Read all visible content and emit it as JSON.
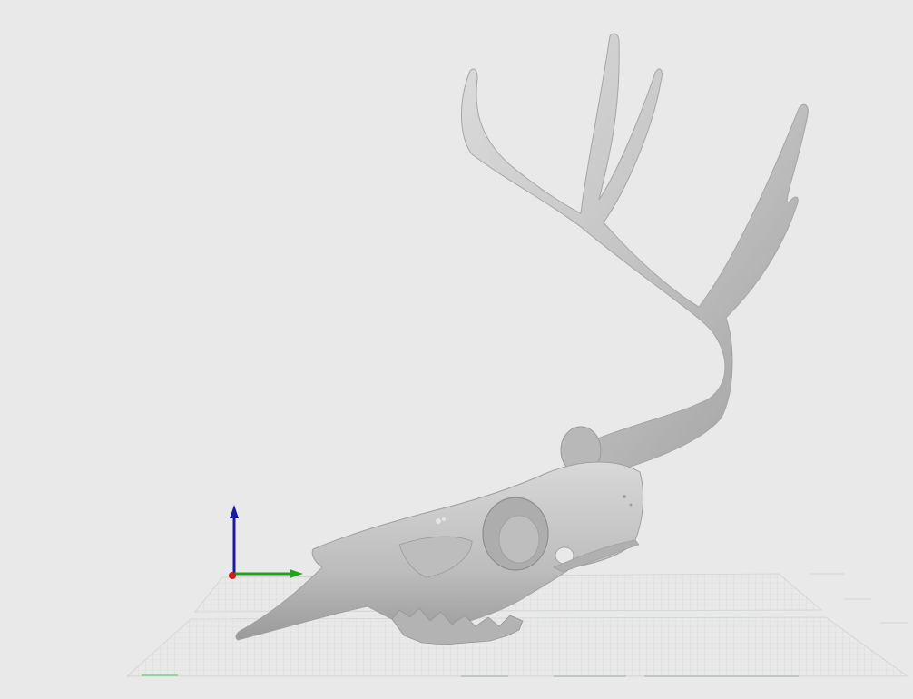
{
  "viewport": {
    "background_color": "#e9e9e9",
    "model_color": "#c8c8c8",
    "grid_color": "#c4cbc6",
    "model_name_icon": "deer-skull-model"
  },
  "axis_gizmo": {
    "x_axis_color": "#c81e1e",
    "y_axis_color": "#1fa21f",
    "z_axis_color": "#1a1aa0"
  }
}
